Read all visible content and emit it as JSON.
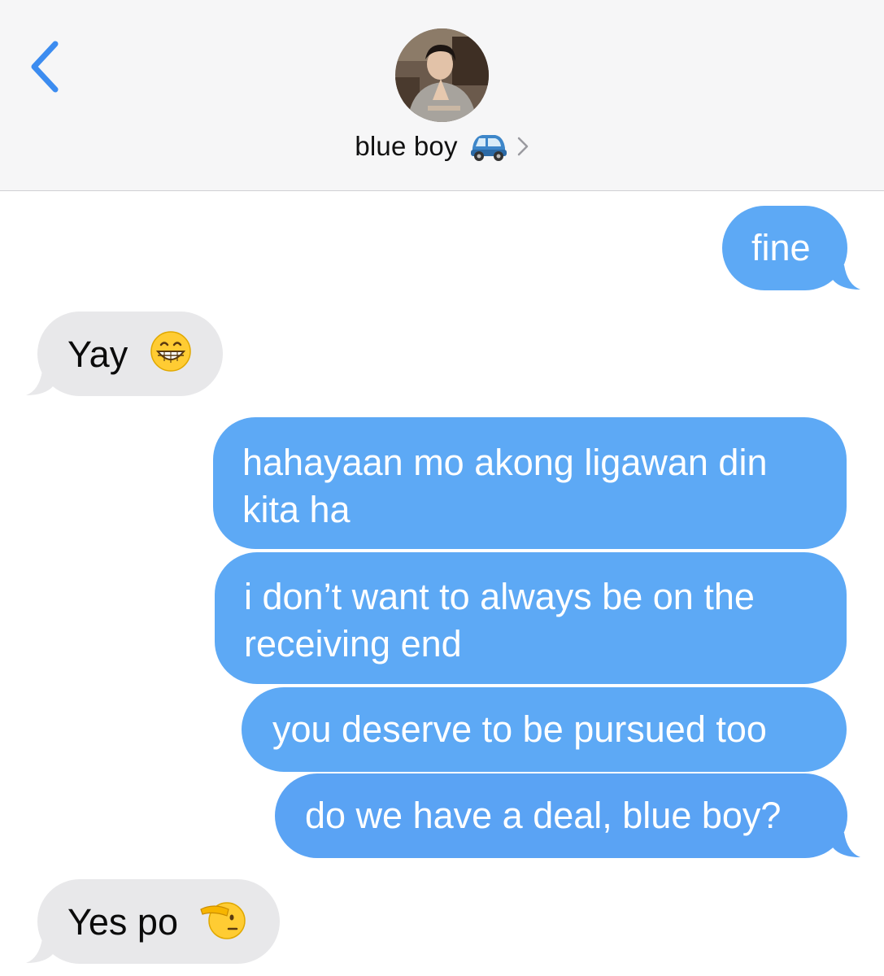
{
  "header": {
    "back_icon": "chevron-left-icon",
    "avatar_icon": "contact-avatar",
    "contact_name": "blue boy",
    "contact_emoji": "car-icon",
    "detail_icon": "chevron-right-icon"
  },
  "colors": {
    "outgoing_bubble": "#5da9f5",
    "incoming_bubble": "#e8e8ea",
    "accent": "#3c8cf0"
  },
  "messages": [
    {
      "direction": "outgoing",
      "text": "fine"
    },
    {
      "direction": "incoming",
      "text": "Yay",
      "emoji": "grinning-face-icon"
    },
    {
      "direction": "outgoing",
      "lines": [
        "hahayaan mo akong ligawan din",
        "kita ha"
      ]
    },
    {
      "direction": "outgoing",
      "lines": [
        "i don’t want to always be on the",
        "receiving end"
      ]
    },
    {
      "direction": "outgoing",
      "text": "you deserve to be pursued too"
    },
    {
      "direction": "outgoing",
      "text": "do we have a deal, blue boy?"
    },
    {
      "direction": "incoming",
      "text": "Yes po",
      "emoji": "saluting-face-icon"
    }
  ]
}
